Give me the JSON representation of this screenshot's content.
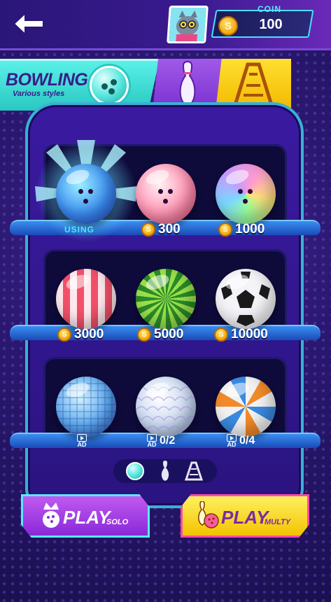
{
  "header": {
    "coin_label": "COIN",
    "coin_value": "100",
    "coin_symbol": "S"
  },
  "tabs": [
    {
      "title": "BOWLING",
      "subtitle": "Various styles",
      "icon": "bowling-ball-icon",
      "active": true
    },
    {
      "title": "",
      "icon": "bowling-pin-icon",
      "active": false
    },
    {
      "title": "",
      "icon": "bowling-lane-icon",
      "active": false
    }
  ],
  "balls": [
    {
      "name": "blue",
      "status": "USING"
    },
    {
      "name": "pink",
      "price": "300"
    },
    {
      "name": "rainbow",
      "price": "1000"
    },
    {
      "name": "striped",
      "price": "3000"
    },
    {
      "name": "watermelon",
      "price": "5000"
    },
    {
      "name": "soccer",
      "price": "10000"
    },
    {
      "name": "disco",
      "unlock_label": "AD"
    },
    {
      "name": "scales",
      "unlock_label": "AD",
      "progress": "0/2"
    },
    {
      "name": "beach",
      "unlock_label": "AD",
      "progress": "0/4"
    }
  ],
  "buttons": {
    "play_solo": "PLAY",
    "play_solo_sub": "SOLO",
    "play_multi": "PLAY",
    "play_multi_sub": "MULTY"
  },
  "colors": {
    "accent_cyan": "#5ae8ff",
    "tab_bowling": "#3ee0d8",
    "tab_pin": "#8a3ae0",
    "tab_lane": "#f7c800",
    "coin_gold": "#f2a800"
  }
}
